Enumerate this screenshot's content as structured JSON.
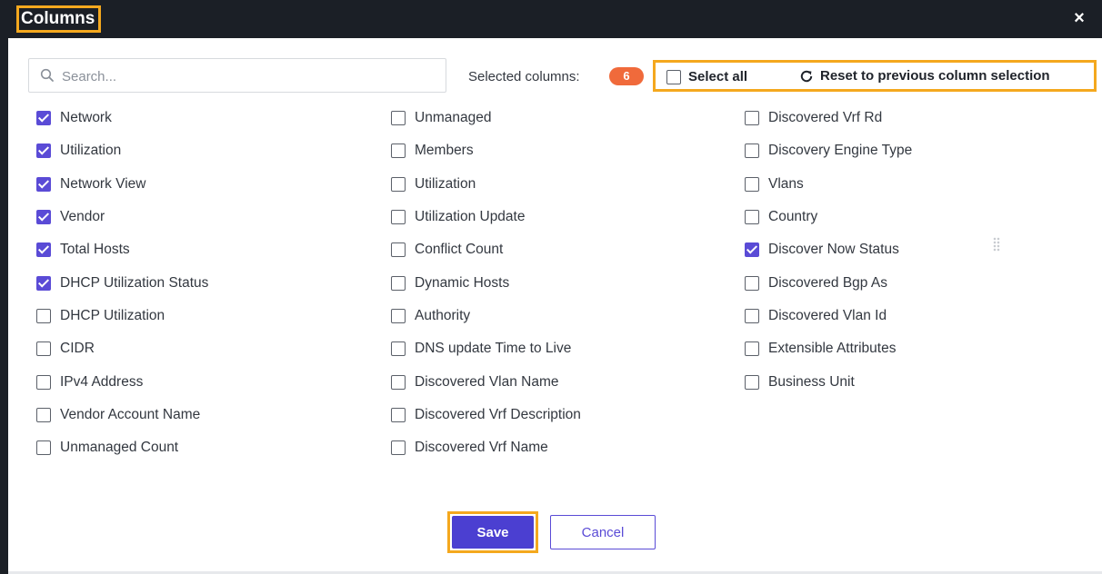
{
  "dialog": {
    "title": "Columns",
    "close_label": "×"
  },
  "search": {
    "placeholder": "Search..."
  },
  "selection": {
    "label": "Selected columns:",
    "count": "6"
  },
  "select_all": {
    "label": "Select all",
    "checked": false
  },
  "reset": {
    "label": "Reset to previous column selection"
  },
  "columns": {
    "col1": [
      {
        "label": "Network",
        "checked": true
      },
      {
        "label": "Utilization",
        "checked": true
      },
      {
        "label": "Network View",
        "checked": true
      },
      {
        "label": "Vendor",
        "checked": true
      },
      {
        "label": "Total Hosts",
        "checked": true
      },
      {
        "label": "DHCP Utilization Status",
        "checked": true
      },
      {
        "label": "DHCP Utilization",
        "checked": false
      },
      {
        "label": "CIDR",
        "checked": false
      },
      {
        "label": "IPv4 Address",
        "checked": false
      },
      {
        "label": "Vendor Account Name",
        "checked": false
      },
      {
        "label": "Unmanaged Count",
        "checked": false
      }
    ],
    "col2": [
      {
        "label": "Unmanaged",
        "checked": false
      },
      {
        "label": "Members",
        "checked": false
      },
      {
        "label": "Utilization",
        "checked": false
      },
      {
        "label": "Utilization Update",
        "checked": false
      },
      {
        "label": "Conflict Count",
        "checked": false
      },
      {
        "label": "Dynamic Hosts",
        "checked": false
      },
      {
        "label": "Authority",
        "checked": false
      },
      {
        "label": "DNS update Time to Live",
        "checked": false
      },
      {
        "label": "Discovered Vlan Name",
        "checked": false
      },
      {
        "label": "Discovered Vrf Description",
        "checked": false
      },
      {
        "label": "Discovered Vrf Name",
        "checked": false
      }
    ],
    "col3": [
      {
        "label": "Discovered Vrf Rd",
        "checked": false
      },
      {
        "label": "Discovery Engine Type",
        "checked": false
      },
      {
        "label": "Vlans",
        "checked": false
      },
      {
        "label": "Country",
        "checked": false
      },
      {
        "label": "Discover Now Status",
        "checked": true
      },
      {
        "label": "Discovered Bgp As",
        "checked": false
      },
      {
        "label": "Discovered Vlan Id",
        "checked": false
      },
      {
        "label": "Extensible Attributes",
        "checked": false
      },
      {
        "label": "Business Unit",
        "checked": false
      }
    ]
  },
  "footer": {
    "save_label": "Save",
    "cancel_label": "Cancel"
  },
  "colors": {
    "accent": "#4b3fd1",
    "badge": "#f06a3b",
    "highlight": "#f4a81e",
    "titlebar": "#1b1f26"
  },
  "icons": [
    "search-icon",
    "refresh-icon",
    "close-icon",
    "drag-handle-icon"
  ]
}
